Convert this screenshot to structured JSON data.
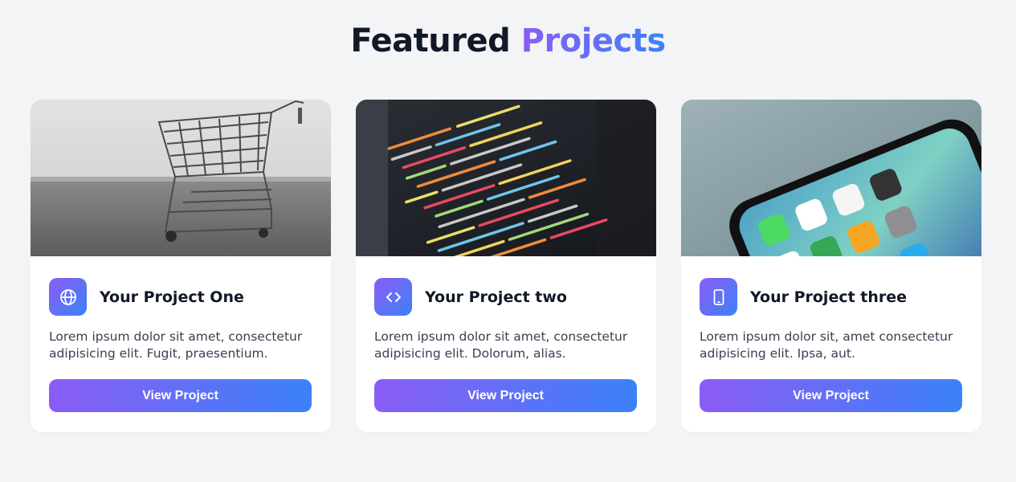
{
  "heading": {
    "main": "Featured",
    "accent": "Projects"
  },
  "colors": {
    "accent_start": "#8b5cf6",
    "accent_end": "#3b82f6",
    "title": "#111827",
    "text": "#374151",
    "background": "#f3f4f6"
  },
  "projects": [
    {
      "title": "Your Project One",
      "description": "Lorem ipsum dolor sit amet, consectetur adipisicing elit. Fugit, praesentium.",
      "button": "View Project",
      "icon": "globe-icon",
      "image": "shopping-cart-photo"
    },
    {
      "title": "Your Project two",
      "description": "Lorem ipsum dolor sit amet, consectetur adipisicing elit. Dolorum, alias.",
      "button": "View Project",
      "icon": "code-icon",
      "image": "code-editor-photo"
    },
    {
      "title": "Your Project three",
      "description": "Lorem ipsum dolor sit, amet consectetur adipisicing elit. Ipsa, aut.",
      "button": "View Project",
      "icon": "smartphone-icon",
      "image": "smartphone-photo"
    }
  ]
}
